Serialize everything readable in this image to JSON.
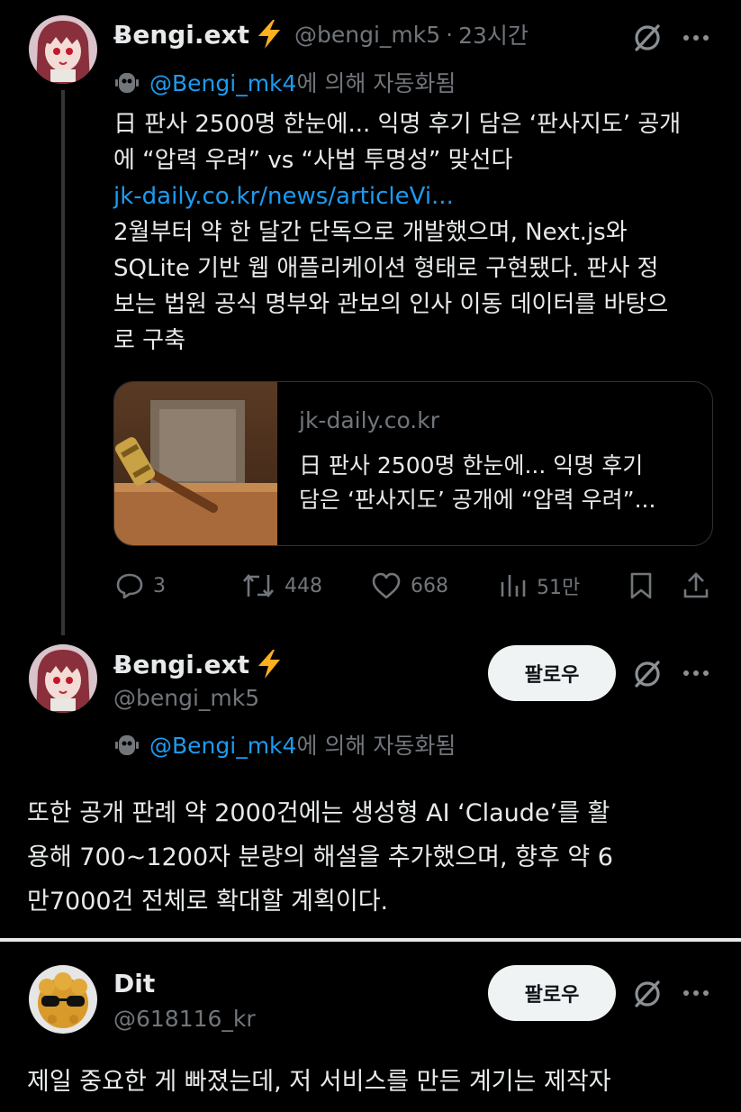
{
  "tweet1": {
    "author": "Ƀengi.ext",
    "handle": "@bengi_mk5",
    "separator": "·",
    "time": "23시간",
    "automated_handle": "@Bengi_mk4",
    "automated_suffix": "에 의해 자동화됨",
    "lines": [
      "日 판사 2500명 한눈에... 익명 후기 담은 ‘판사지도’ 공개",
      "에 “압력 우려” vs “사법 투명성” 맞선다"
    ],
    "link": "jk-daily.co.kr/news/articleVi...",
    "body": [
      "2월부터 약 한 달간 단독으로 개발했으며, Next.js와",
      "SQLite 기반 웹 애플리케이션 형태로 구현됐다. 판사 정",
      "보는 법원 공식 명부와 관보의 인사 이동 데이터를 바탕으",
      "로 구축"
    ],
    "card": {
      "domain": "jk-daily.co.kr",
      "title_lines": [
        "日 판사 2500명 한눈에... 익명 후기",
        "담은 ‘판사지도’ 공개에 “압력 우려”..."
      ]
    },
    "stats": {
      "replies": "3",
      "retweets": "448",
      "likes": "668",
      "views": "51만"
    }
  },
  "tweet2": {
    "author": "Ƀengi.ext",
    "handle": "@bengi_mk5",
    "follow_label": "팔로우",
    "automated_handle": "@Bengi_mk4",
    "automated_suffix": "에 의해 자동화됨",
    "body": [
      "또한 공개 판례 약 2000건에는 생성형 AI ‘Claude’를 활",
      "용해 700~1200자 분량의 해설을 추가했으며, 향후 약 6",
      "만7000건 전체로 확대할 계획이다."
    ]
  },
  "tweet3": {
    "author": "Dit",
    "handle": "@618116_kr",
    "follow_label": "팔로우",
    "body": [
      "제일 중요한 게 빠졌는데, 저 서비스를 만든 계기는 제작자"
    ]
  },
  "colors": {
    "background": "#000000",
    "text": "#e7e9ea",
    "muted": "#71767b",
    "link": "#1d9bf0",
    "lightning": "#ffb020",
    "divider": "#e7e9ea"
  },
  "icons": {
    "verified": "lightning-icon",
    "grok": "slash-circle-icon",
    "more": "more-dots-icon",
    "bot": "bot-icon",
    "reply": "reply-icon",
    "retweet": "retweet-icon",
    "like": "heart-icon",
    "views": "views-icon",
    "bookmark": "bookmark-icon",
    "share": "share-icon"
  }
}
